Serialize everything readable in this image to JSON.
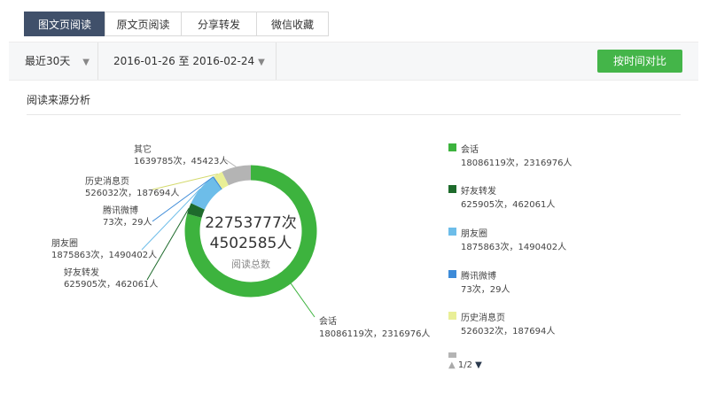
{
  "tabs": [
    {
      "label": "图文页阅读",
      "active": true
    },
    {
      "label": "原文页阅读",
      "active": false
    },
    {
      "label": "分享转发",
      "active": false
    },
    {
      "label": "微信收藏",
      "active": false
    }
  ],
  "filters": {
    "range_label": "最近30天",
    "date_range": "2016-01-26 至 2016-02-24",
    "compare_button": "按时间对比"
  },
  "section_title": "阅读来源分析",
  "colors": {
    "accent_green": "#44b549",
    "tab_active": "#40506a"
  },
  "chart_data": {
    "type": "pie",
    "center": {
      "total_reads": "22753777次",
      "total_people": "4502585人",
      "label": "阅读总数"
    },
    "slices": [
      {
        "name": "会话",
        "reads": 18086119,
        "people": 2316976,
        "value_text": "18086119次，2316976人",
        "color": "#3db33e"
      },
      {
        "name": "好友转发",
        "reads": 625905,
        "people": 462061,
        "value_text": "625905次，462061人",
        "color": "#1e6b2c"
      },
      {
        "name": "朋友圈",
        "reads": 1875863,
        "people": 1490402,
        "value_text": "1875863次，1490402人",
        "color": "#6dbde9"
      },
      {
        "name": "腾讯微博",
        "reads": 73,
        "people": 29,
        "value_text": "73次，29人",
        "color": "#3d8bd8"
      },
      {
        "name": "历史消息页",
        "reads": 526032,
        "people": 187694,
        "value_text": "526032次，187694人",
        "color": "#e9ef97"
      },
      {
        "name": "其它",
        "reads": 1639785,
        "people": 45423,
        "value_text": "1639785次，45423人",
        "color": "#b4b4b4"
      }
    ]
  },
  "legend": {
    "items": [
      {
        "name": "会话",
        "value_text": "18086119次，2316976人"
      },
      {
        "name": "好友转发",
        "value_text": "625905次，462061人"
      },
      {
        "name": "朋友圈",
        "value_text": "1875863次，1490402人"
      },
      {
        "name": "腾讯微博",
        "value_text": "73次，29人"
      },
      {
        "name": "历史消息页",
        "value_text": "526032次，187694人"
      }
    ],
    "pager_text": "1/2"
  }
}
